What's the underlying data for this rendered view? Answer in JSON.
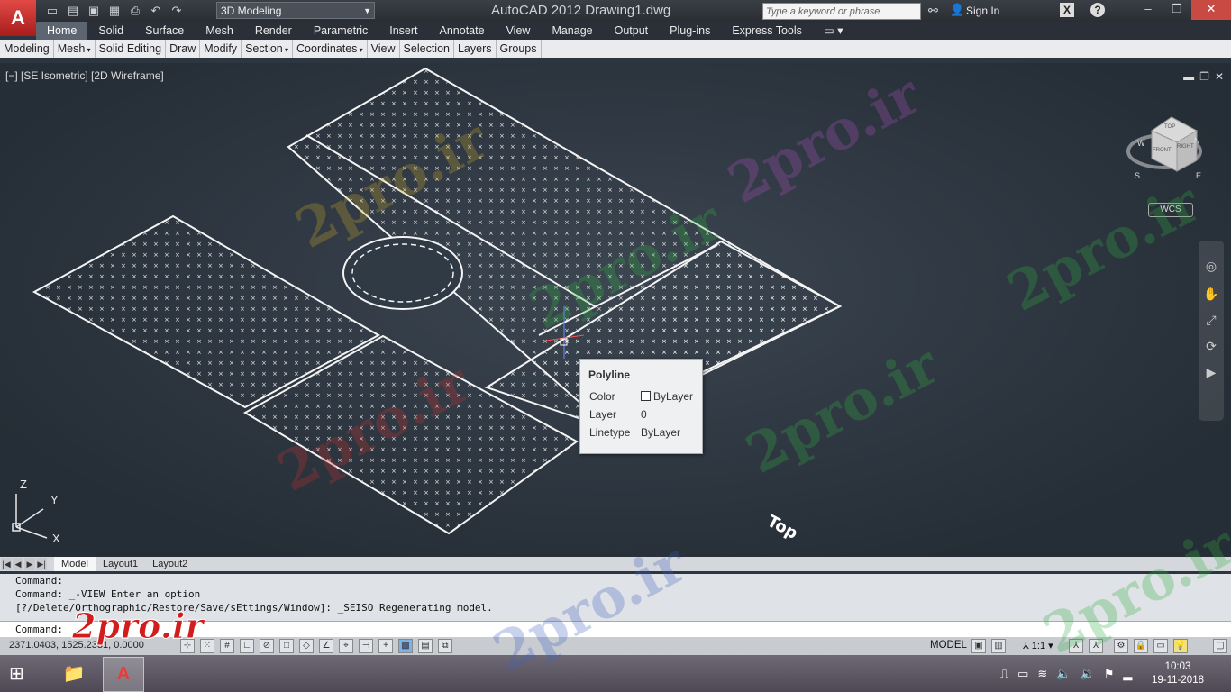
{
  "title_bar": {
    "window_title": "AutoCAD 2012    Drawing1.dwg",
    "workspace": "3D Modeling",
    "search_placeholder": "Type a keyword or phrase",
    "sign_in": "Sign In"
  },
  "ribbon": {
    "tabs": [
      "Home",
      "Solid",
      "Surface",
      "Mesh",
      "Render",
      "Parametric",
      "Insert",
      "Annotate",
      "View",
      "Manage",
      "Output",
      "Plug-ins",
      "Express Tools"
    ],
    "active_tab": "Home",
    "panels": [
      "Modeling",
      "Mesh",
      "Solid Editing",
      "Draw",
      "Modify",
      "Section",
      "Coordinates",
      "View",
      "Selection",
      "Layers",
      "Groups"
    ]
  },
  "viewport": {
    "label": "[−] [SE Isometric] [2D Wireframe]",
    "viewcube_faces": [
      "TOP",
      "FRONT",
      "RIGHT"
    ],
    "viewcube_compass": [
      "N",
      "W",
      "S",
      "E"
    ],
    "wcs_label": "WCS",
    "ucs_axes": [
      "Z",
      "Y",
      "X"
    ]
  },
  "tooltip": {
    "title": "Polyline",
    "rows": [
      {
        "label": "Color",
        "value": "ByLayer"
      },
      {
        "label": "Layer",
        "value": "0"
      },
      {
        "label": "Linetype",
        "value": "ByLayer"
      }
    ]
  },
  "layout_tabs": [
    "Model",
    "Layout1",
    "Layout2"
  ],
  "command": {
    "history": [
      "Command:",
      "Command: _-VIEW Enter an option",
      "[?/Delete/Orthographic/Restore/Save/sEttings/Window]: _SEISO Regenerating model."
    ],
    "prompt": "Command:"
  },
  "status_bar": {
    "coordinates": "2371.0403, 1525.2331, 0.0000",
    "model_label": "MODEL",
    "annotation_scale": "1:1"
  },
  "taskbar": {
    "time": "10:03",
    "date": "19-11-2018"
  },
  "watermark_text": "2pro.ir",
  "colors": {
    "accent": "#e1403c",
    "ribbon_bg": "#2b3038",
    "canvas_bg": "#2c3540"
  }
}
